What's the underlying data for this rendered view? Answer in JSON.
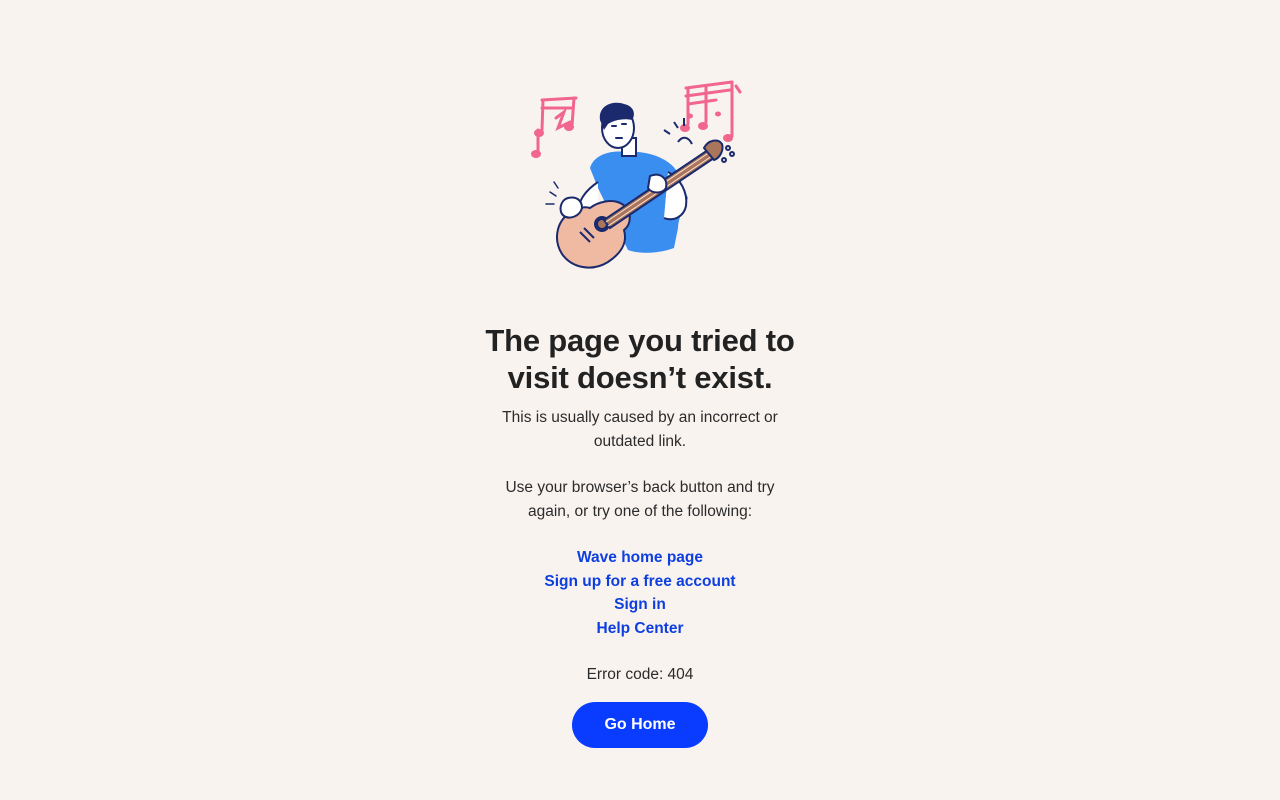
{
  "error_page": {
    "title_line1": "The page you tried to",
    "title_line2": "visit doesn’t exist.",
    "cause_line1": "This is usually caused by an incorrect or",
    "cause_line2": "outdated link.",
    "advice_line1": "Use your browser’s back button and try",
    "advice_line2": "again, or try one of the following:",
    "links": [
      {
        "label": "Wave home page"
      },
      {
        "label": "Sign up for a free account"
      },
      {
        "label": "Sign in"
      },
      {
        "label": "Help Center"
      }
    ],
    "error_code": "Error code: 404",
    "go_home_label": "Go Home"
  },
  "illustration": {
    "icon": "guitar-player-illustration",
    "colors": {
      "shirt": "#3a8ef0",
      "guitar_body": "#f0b9a2",
      "guitar_neck": "#a9765c",
      "music_notes": "#f0668c",
      "outline": "#1a2a6c"
    }
  },
  "theme": {
    "background": "#f9f3f0",
    "link_color": "#0d3fe0",
    "button_color": "#0a3cff"
  }
}
